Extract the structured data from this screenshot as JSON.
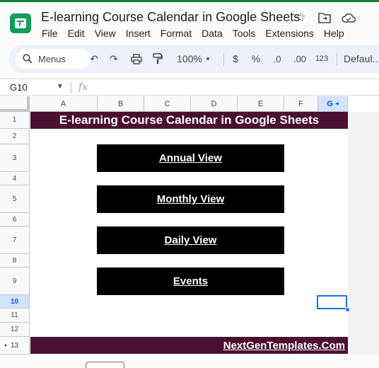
{
  "doc": {
    "title": "E-learning Course Calendar in Google Sheets"
  },
  "menu": [
    "File",
    "Edit",
    "View",
    "Insert",
    "Format",
    "Data",
    "Tools",
    "Extensions",
    "Help"
  ],
  "toolbar": {
    "search_label": "Menus",
    "zoom": "100%",
    "currency": "$",
    "percent": "%",
    "decrease_decimal": ".0",
    "increase_decimal": ".00",
    "number_format": "123",
    "font": "Defaul..."
  },
  "formula_bar": {
    "cell_ref": "G10",
    "fx": "fx"
  },
  "columns": [
    "A",
    "B",
    "C",
    "D",
    "E",
    "F",
    "G"
  ],
  "rows": [
    "1",
    "2",
    "3",
    "4",
    "5",
    "6",
    "7",
    "8",
    "9",
    "10",
    "11",
    "12",
    "13"
  ],
  "sheet": {
    "title": "E-learning Course Calendar in Google Sheets",
    "buttons": [
      "Annual View",
      "Monthly View",
      "Daily View",
      "Events"
    ],
    "footer": "NextGenTemplates.Com"
  },
  "colors": {
    "banner": "#4b1030",
    "button": "#000000",
    "accent": "#1a73e8"
  }
}
